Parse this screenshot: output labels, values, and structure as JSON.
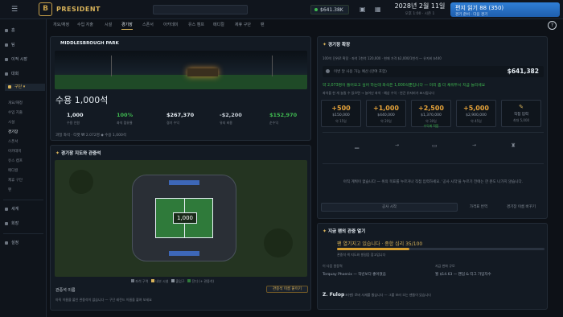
{
  "topbar": {
    "brand": "PRESIDENT",
    "logo_letter": "B",
    "money": "$641.38K",
    "date": "2028년 2월 11일",
    "date_sub": "오후 1:00 · 시즌 1",
    "go_button": "편지 읽기 88 (350)",
    "go_sub": "경기 준비 · 다음 경기"
  },
  "sidebar": {
    "items": [
      "홈",
      "팀",
      "이적 시장",
      "대회",
      "구단"
    ],
    "club_sub": [
      "개요/재정",
      "수입 지출",
      "시설",
      "경기장",
      "스폰서",
      "아카데미",
      "유스 캠프",
      "메디컬",
      "제휴 구단",
      "팬"
    ],
    "bottom": [
      "세계",
      "회장",
      "설정"
    ]
  },
  "tabs": [
    "개요/재정",
    "수입 지출",
    "시설",
    "경기장",
    "스폰서",
    "아카데미",
    "유스 캠프",
    "메디컬",
    "제휴 구단",
    "팬"
  ],
  "stadium": {
    "name": "MIDDLESBROUGH PARK",
    "capacity": "수용 1,000석",
    "stats": [
      {
        "value": "1,000",
        "label": "수용 인원"
      },
      {
        "value": "100%",
        "label": "좌석 점유율"
      },
      {
        "value": "$267,370",
        "label": "경기 수익"
      },
      {
        "value": "-$2,200",
        "label": "유지 비용"
      },
      {
        "value": "$152,970",
        "label": "순수익"
      }
    ],
    "note": "과밀 좌석 · 티켓 ₩ 2.072명 ◆ 수용 1,000석"
  },
  "map": {
    "title": "경기장 지도와 관중석",
    "center": "1,000",
    "legend": [
      "좌석 구역",
      "내부 시설",
      "출입구",
      "잔디 (+ 관중석)"
    ],
    "footer_title": "관중석 이름",
    "footer_text": "아직 이름을 붙인 관중석이 없습니다 — 구단 레전드 이름을 붙여 보세요",
    "rename_button": "관중석 이름 붙이기"
  },
  "expand": {
    "title": "경기장 확장",
    "subtitle": "100석 단위로 확장 · 좌석 1천석 120,000 · 현재 가격 $2,000/1천석 — 유지비 $440",
    "budget_label": "이번 달 사용 가능 예산 (잔여 포함)",
    "budget": "$641,382",
    "alert": "약 2,073명이 들어오고 싶어 하는데 좌석은 1,000석뿐입니다 — 미리 좀 더 채워두시 지금 늘리세요",
    "alert_sub": "좌석을 한 개 늘릴 수 있으면 → 늘어난 좌석 · 예상 수익 · 연간 유지비가 표시됩니다",
    "options": [
      {
        "value": "+500",
        "price": "$150,000",
        "detail": "약 15일"
      },
      {
        "value": "+1,000",
        "price": "$440,000",
        "detail": "약 20일"
      },
      {
        "value": "+2,500",
        "price": "$1,370,000",
        "detail": "약 30일"
      },
      {
        "value": "+5,000",
        "price": "$2,900,000",
        "detail": "약 45일"
      },
      {
        "value": "직접 입력",
        "price": "최대 5,000",
        "detail": ""
      }
    ],
    "option3_tag": "수익에 적합",
    "info": "아직 계획이 없습니다 — 위의 목표를 누르거나 직접 입력하세요. '공사 시작'을 누르기 전에는 한 푼도 나가지 않습니다.",
    "start_button": "공사 시작",
    "reset_button": "가격표 번역",
    "rename_button": "경기장 이름 바꾸기"
  },
  "fans": {
    "title": "지금 팬의 관중 열기",
    "status": "팬 열기지고 있습니다 · 종합 심리 35/100",
    "status_sub": "관중석 색 지도와 발걸음 참고입니다",
    "mood_pct": 35,
    "source_label": "이 다음 원동력",
    "source_value": "Torquay Phoenix — 작년보다 좋아졌음",
    "change_label": "지금 변화 규모",
    "change_value": "월 $14.63 — 팬덤 & 티그 가입자수",
    "player": "Z. Fulop",
    "player_note": "포(팬) 로버 사재를 봤습니다 — 그를 보러 오는 팬들이 있습니다"
  },
  "colors": {
    "accent": "#d8b35a",
    "green": "#3fb950",
    "blue": "#2f7fd6",
    "bg": "#0d1117"
  }
}
